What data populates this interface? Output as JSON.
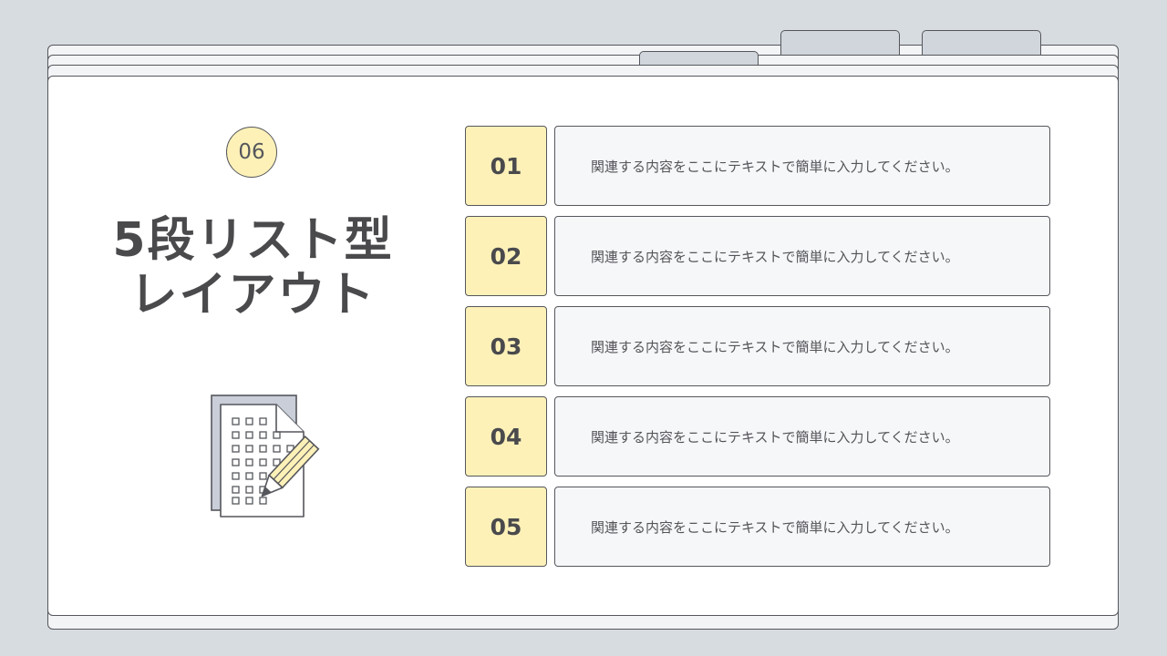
{
  "slide": {
    "badge": "06",
    "title_line1": "5段リスト型",
    "title_line2": "レイアウト",
    "illustration_icon": "document-with-pencil-icon"
  },
  "list": {
    "items": [
      {
        "number": "01",
        "text": "関連する内容をここにテキストで簡単に入力してください。"
      },
      {
        "number": "02",
        "text": "関連する内容をここにテキストで簡単に入力してください。"
      },
      {
        "number": "03",
        "text": "関連する内容をここにテキストで簡単に入力してください。"
      },
      {
        "number": "04",
        "text": "関連する内容をここにテキストで簡単に入力してください。"
      },
      {
        "number": "05",
        "text": "関連する内容をここにテキストで簡単に入力してください。"
      }
    ]
  },
  "colors": {
    "background": "#d7dce1",
    "accent_yellow": "#fdf1b8",
    "outline": "#55575c",
    "text": "#4a4a4d",
    "tab_gray": "#d1d6dd"
  }
}
